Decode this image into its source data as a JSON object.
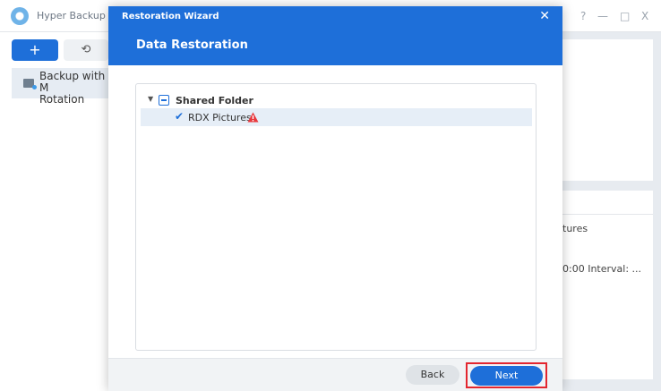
{
  "app": {
    "title": "Hyper Backup",
    "window_controls": {
      "help": "?",
      "minimize": "—",
      "maximize": "□",
      "close": "X"
    }
  },
  "sidebar": {
    "add_button": "+",
    "restore_button": "⟲",
    "tasks": [
      {
        "label": "Backup with M\nRotation"
      }
    ]
  },
  "background_details": {
    "line_1": "tures",
    "line_2": "0:00 Interval: ..."
  },
  "wizard": {
    "window_title": "Restoration Wizard",
    "close_label": "✕",
    "heading": "Data Restoration",
    "tree": {
      "root": {
        "label": "Shared Folder",
        "expanded": true,
        "state": "partial"
      },
      "items": [
        {
          "label": "RDX Pictures",
          "checked": true,
          "warning": true
        }
      ]
    },
    "footer": {
      "back_label": "Back",
      "next_label": "Next"
    }
  },
  "colors": {
    "accent": "#1e6fd9",
    "highlight_frame": "#e3262f",
    "warning": "#e8383d"
  }
}
